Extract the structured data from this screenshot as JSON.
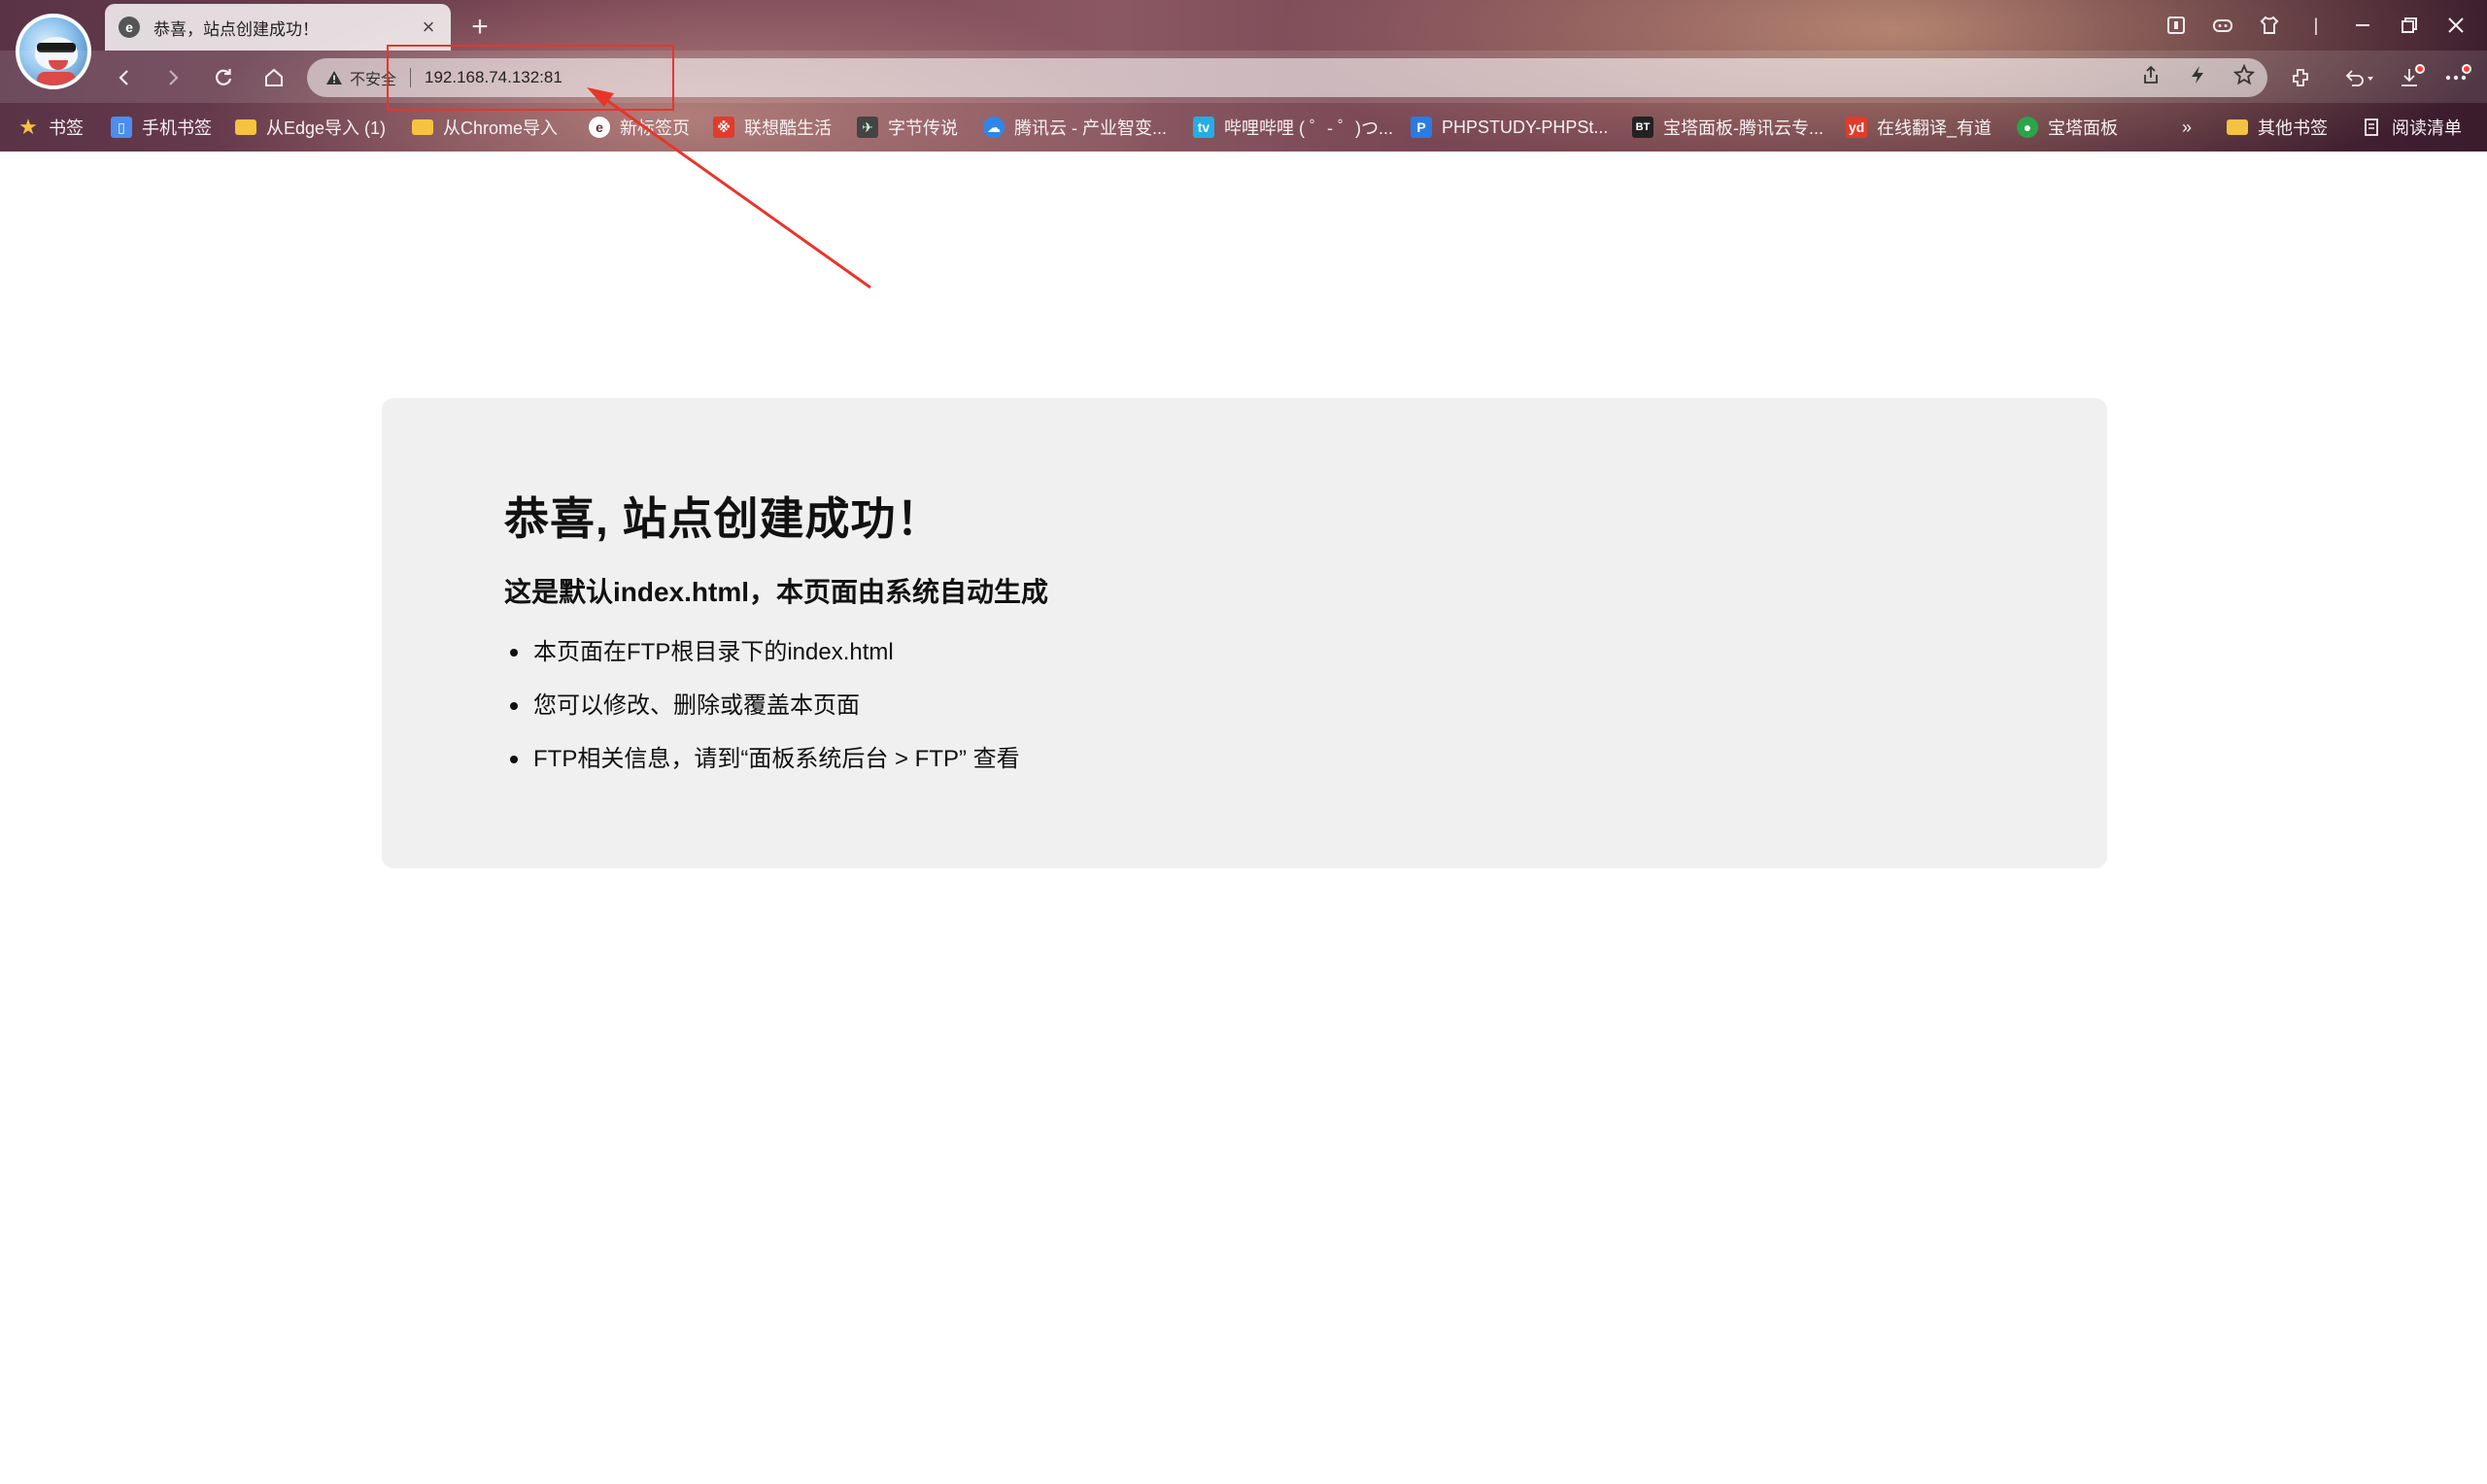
{
  "tab": {
    "favicon": "edge-e-icon",
    "title": "恭喜，站点创建成功！",
    "close": "×",
    "new_tab": "+"
  },
  "toolbar": {
    "security_label": "不安全",
    "url": "192.168.74.132:81"
  },
  "bookmarks": [
    {
      "label": "书签",
      "icon": "star-icon"
    },
    {
      "label": "手机书签",
      "icon": "phone-doc-icon"
    },
    {
      "label": "从Edge导入 (1)",
      "icon": "folder-icon"
    },
    {
      "label": "从Chrome导入",
      "icon": "folder-icon"
    },
    {
      "label": "新标签页",
      "icon": "edge-icon"
    },
    {
      "label": "联想酷生活",
      "icon": "lenovo-icon"
    },
    {
      "label": "字节传说",
      "icon": "bytes-icon"
    },
    {
      "label": "腾讯云 - 产业智变...",
      "icon": "tencent-cloud-icon"
    },
    {
      "label": "哔哩哔哩 ( ゜- ゜)つ...",
      "icon": "bilibili-icon"
    },
    {
      "label": "PHPSTUDY-PHPSt...",
      "icon": "phpstudy-icon"
    },
    {
      "label": "宝塔面板-腾讯云专...",
      "icon": "bt-icon"
    },
    {
      "label": "在线翻译_有道",
      "icon": "youdao-icon"
    },
    {
      "label": "宝塔面板",
      "icon": "bt-green-icon"
    }
  ],
  "bookmarks_overflow": "»",
  "other_bookmarks": "其他书签",
  "reading_list": "阅读清单",
  "page": {
    "heading": "恭喜, 站点创建成功！",
    "subheading": "这是默认index.html，本页面由系统自动生成",
    "items": [
      "本页面在FTP根目录下的index.html",
      "您可以修改、删除或覆盖本页面",
      "FTP相关信息，请到“面板系统后台 > FTP” 查看"
    ]
  },
  "colors": {
    "annotation": "#e8352a",
    "card_background": "#f0f0f0"
  }
}
